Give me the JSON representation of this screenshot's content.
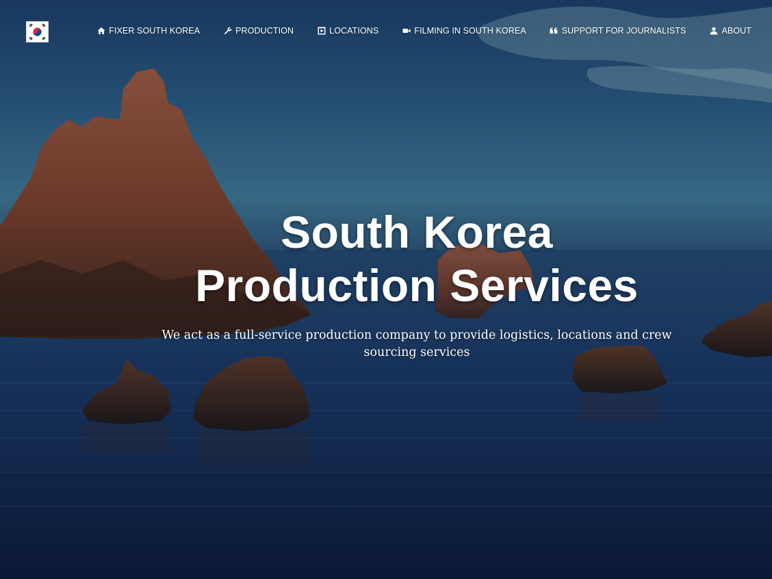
{
  "brand": {
    "logo_icon": "south-korea-flag-icon"
  },
  "nav": {
    "items": [
      {
        "label": "FIXER SOUTH KOREA",
        "icon": "home-icon"
      },
      {
        "label": "PRODUCTION",
        "icon": "wrench-icon"
      },
      {
        "label": "LOCATIONS",
        "icon": "film-frame-icon"
      },
      {
        "label": "FILMING IN SOUTH KOREA",
        "icon": "video-camera-icon"
      },
      {
        "label": "SUPPORT FOR JOURNALISTS",
        "icon": "quote-icon"
      },
      {
        "label": "ABOUT",
        "icon": "user-icon"
      }
    ]
  },
  "hero": {
    "title": "South Korea Production Services",
    "subtitle": "We act as a full-service production company to provide logistics, locations and crew sourcing services"
  },
  "colors": {
    "sky": "#2a5a82",
    "sea": "#15305a",
    "rock": "#8a4a38",
    "text": "#ffffff"
  }
}
